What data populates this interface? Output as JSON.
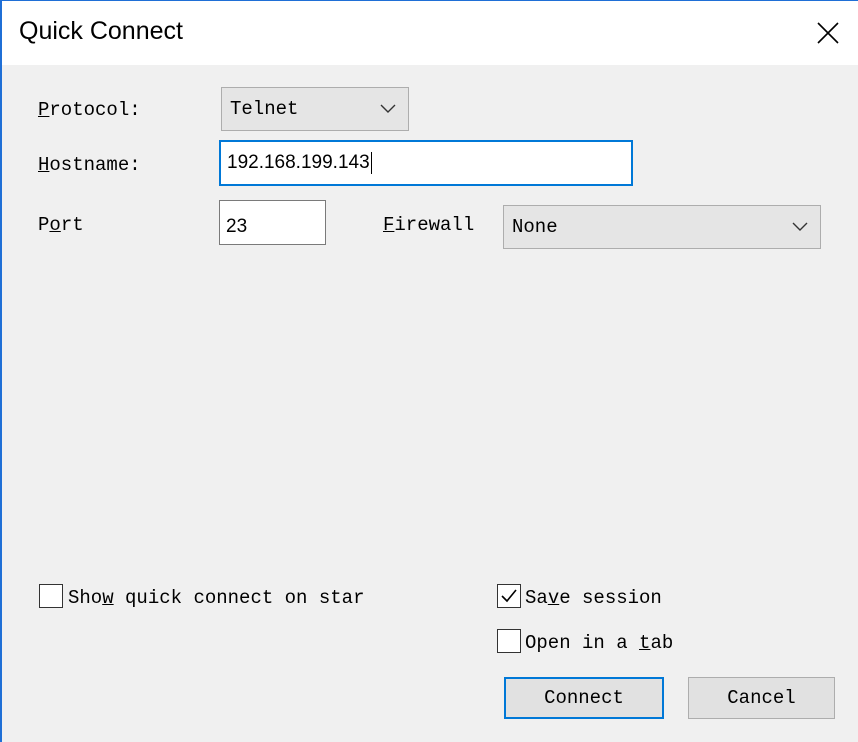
{
  "window": {
    "title": "Quick Connect"
  },
  "protocol": {
    "label_prefix": "",
    "label_access": "P",
    "label_rest": "rotocol:",
    "value": "Telnet"
  },
  "hostname": {
    "label_access": "H",
    "label_rest": "ostname:",
    "value": "192.168.199.143"
  },
  "port": {
    "label_first": "P",
    "label_access": "o",
    "label_rest": "rt",
    "value": "23"
  },
  "firewall": {
    "label_access": "F",
    "label_rest": "irewall",
    "value": "None"
  },
  "options": {
    "show_quick_connect": {
      "pre": "Sho",
      "access": "w",
      "post": " quick connect on star",
      "checked": false
    },
    "save_session": {
      "pre": "Sa",
      "access": "v",
      "post": "e session",
      "checked": true
    },
    "open_in_tab": {
      "pre": "Open in a ",
      "access": "t",
      "post": "ab",
      "checked": false
    }
  },
  "buttons": {
    "connect": "Connect",
    "cancel": "Cancel"
  },
  "colors": {
    "accent": "#0078d7",
    "window_border": "#1f6fd6",
    "dialog_bg": "#f0f0f0"
  }
}
